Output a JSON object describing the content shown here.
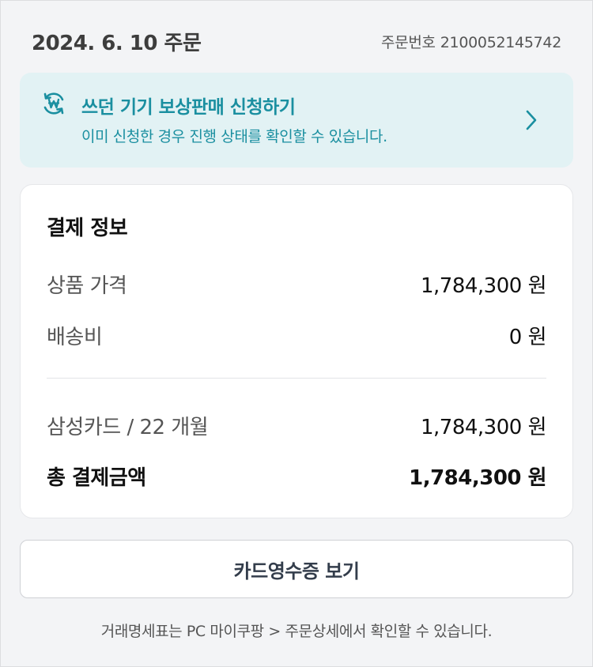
{
  "header": {
    "order_date": "2024. 6. 10 주문",
    "order_number_label": "주문번호",
    "order_number": "2100052145742"
  },
  "tradein_banner": {
    "icon": "won-exchange-icon",
    "title": "쓰던 기기 보상판매 신청하기",
    "subtitle": "이미 신청한 경우 진행 상태를 확인할 수 있습니다.",
    "chevron_icon": "chevron-right-icon",
    "accent_color": "#1a8fa0",
    "background_color": "#e2f2f4"
  },
  "payment": {
    "title": "결제 정보",
    "product_price": {
      "label": "상품 가격",
      "value": "1,784,300 원"
    },
    "shipping_fee": {
      "label": "배송비",
      "value": "0 원"
    },
    "card_payment": {
      "label": "삼성카드 / 22 개월",
      "value": "1,784,300 원"
    },
    "total": {
      "label": "총 결제금액",
      "value": "1,784,300 원"
    }
  },
  "receipt_button": {
    "label": "카드영수증 보기"
  },
  "footer": {
    "note": "거래명세표는 PC 마이쿠팡 > 주문상세에서 확인할 수 있습니다."
  }
}
